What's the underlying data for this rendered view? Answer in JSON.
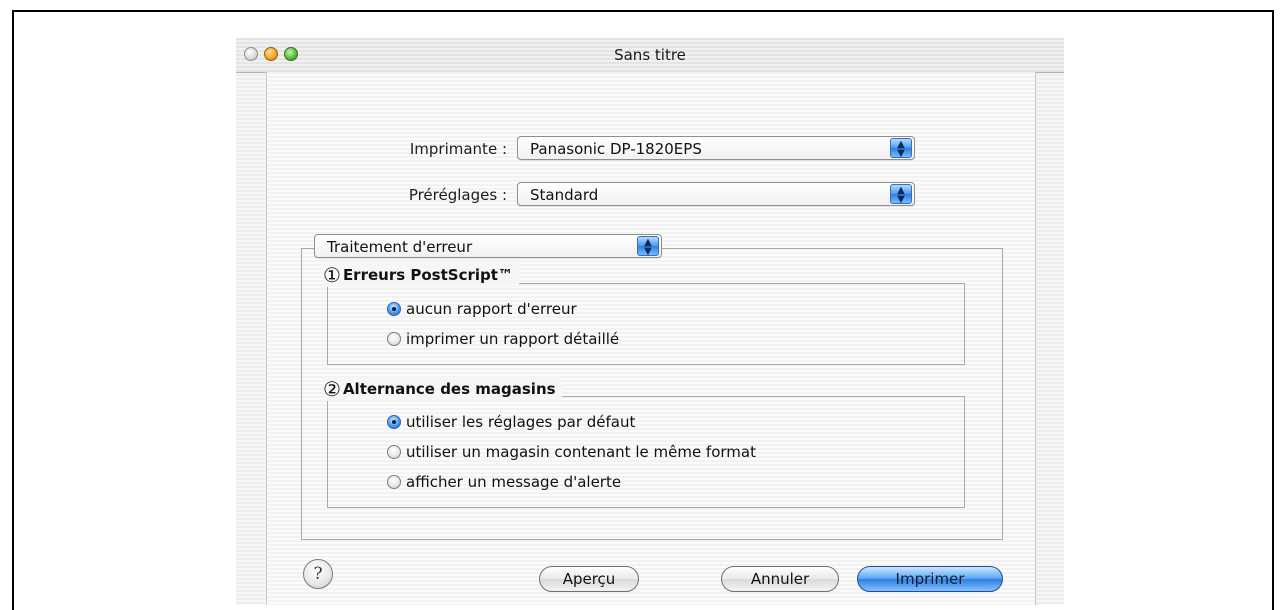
{
  "window": {
    "title": "Sans titre"
  },
  "printer_row": {
    "label": "Imprimante :",
    "value": "Panasonic DP-1820EPS"
  },
  "presets_row": {
    "label": "Préréglages :",
    "value": "Standard"
  },
  "panel_menu": {
    "value": "Traitement d'erreur"
  },
  "postscript_errors": {
    "marker": "①",
    "title": "Erreurs PostScript™",
    "options": [
      "aucun rapport d'erreur",
      "imprimer un rapport détaillé"
    ],
    "selected_index": 0
  },
  "tray_switching": {
    "marker": "②",
    "title": "Alternance des magasins",
    "options": [
      "utiliser les réglages par défaut",
      "utiliser un magasin contenant le même format",
      "afficher un message d'alerte"
    ],
    "selected_index": 0
  },
  "buttons": {
    "help": "?",
    "preview": "Aperçu",
    "cancel": "Annuler",
    "print": "Imprimer"
  },
  "colors": {
    "accent_blue": "#4a9af0",
    "desktop_blue": "#3a67a8"
  },
  "icons": {
    "close": "close-icon",
    "minimize": "minimize-icon",
    "zoom": "zoom-icon",
    "popup_arrows": "up-down-arrows-icon"
  }
}
